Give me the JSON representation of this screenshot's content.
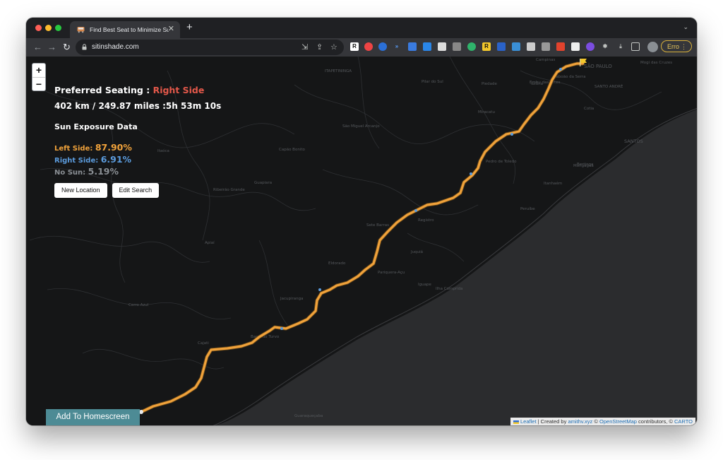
{
  "browser": {
    "tab_title": "Find Best Seat to Minimize Su",
    "tab_close": "✕",
    "new_tab": "+",
    "tab_menu": "⌄",
    "url": "sitinshade.com",
    "profile_label": "Erro",
    "profile_menu": "⋮",
    "nav": {
      "back": "←",
      "forward": "→",
      "reload": "↻"
    },
    "omnibox_icons": {
      "install": "⇲",
      "share": "⇪",
      "bookmark": "☆"
    }
  },
  "map": {
    "zoom_in": "+",
    "zoom_out": "−",
    "labels": [
      "ITAPETININGA",
      "Campinas",
      "SÃO PAULO",
      "SANTO ANDRÉ",
      "SANTOS",
      "Mogi das Cruzes",
      "Bertioga",
      "Itanhaém",
      "Registro",
      "Peruíbe",
      "Sorocaba",
      "Piedade",
      "Ibiúna",
      "Juquiá",
      "Iguape",
      "Apiaí",
      "Cerro Azul",
      "Capão Bonito",
      "Guapiara",
      "Eldorado",
      "Jacupiranga",
      "Pariquera-Açu",
      "Ilha Comprida",
      "Cajati",
      "Itaóca",
      "Itanhaém",
      "Ribeirão Grande",
      "Pilar do Sul",
      "São Miguel Arcanjo",
      "Tatuí",
      "Cotia",
      "Embu das Artes",
      "Taboão da Serra",
      "Mongaguá",
      "Miracatu",
      "Pedro de Toledo",
      "Sete Barras",
      "Barra do Turvo",
      "Guaraqueçaba"
    ]
  },
  "panel": {
    "pref_label": "Preferred Seating : ",
    "pref_value": "Right Side",
    "distance": "402 km / 249.87 miles :5h 53m 10s",
    "sun_header": "Sun Exposure Data",
    "left_label": "Left Side: ",
    "left_value": "87.90%",
    "right_label": "Right Side: ",
    "right_value": "6.91%",
    "nosun_label": "No Sun: ",
    "nosun_value": "5.19%",
    "btn_new": "New Location",
    "btn_edit": "Edit Search"
  },
  "home_button": "Add To Homescreen",
  "attribution": {
    "leaflet": "Leaflet",
    "sep1": " | Created by ",
    "author": "amithv.xyz",
    "sep2": " © ",
    "osm": "OpenStreetMap",
    "sep3": " contributors, © ",
    "carto": "CARTO"
  },
  "colors": {
    "route": "#f0a23b",
    "route_shade": "#5b9bdc",
    "pref_value": "#e3584a",
    "land": "#151617",
    "sea": "#2b2c2e"
  }
}
